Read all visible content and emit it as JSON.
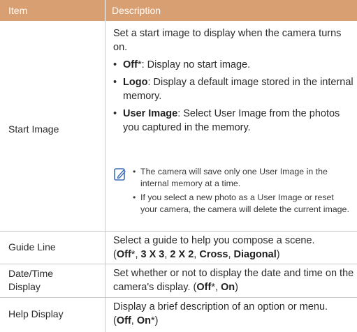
{
  "header": {
    "item": "Item",
    "description": "Description"
  },
  "start_image": {
    "label": "Start Image",
    "intro": "Set a start image to display when the camera turns on.",
    "bullets": [
      {
        "term": "Off",
        "mark": "*",
        "text": ": Display no start image."
      },
      {
        "term": "Logo",
        "mark": "",
        "text": ": Display a default image stored in the internal memory."
      },
      {
        "term": "User Image",
        "mark": "",
        "text": ": Select User Image from the photos you captured in the memory."
      }
    ],
    "notes": [
      "The camera will save only one User Image in the internal memory at a time.",
      "If you select a new photo as a User Image or reset your camera, the camera will delete the current image."
    ]
  },
  "guide_line": {
    "label": "Guide Line",
    "text": "Select a guide to help you compose a scene.",
    "options": [
      "Off",
      "3 X 3",
      "2 X 2",
      "Cross",
      "Diagonal"
    ],
    "default_mark": "*"
  },
  "date_time": {
    "label_1": "Date/Time",
    "label_2": "Display",
    "text": "Set whether or not to display the date and time on the camera's display.",
    "options": [
      "Off",
      "On"
    ],
    "default_mark": "*"
  },
  "help_display": {
    "label": "Help Display",
    "text": "Display a brief description of an option or menu.",
    "options": [
      "Off",
      "On"
    ],
    "default_mark": "*"
  },
  "colors": {
    "header_bg": "#d89f72",
    "rule": "#c9c9c9",
    "note_icon": "#3f6fb6"
  },
  "icons": {
    "note": "note-pencil-icon"
  }
}
